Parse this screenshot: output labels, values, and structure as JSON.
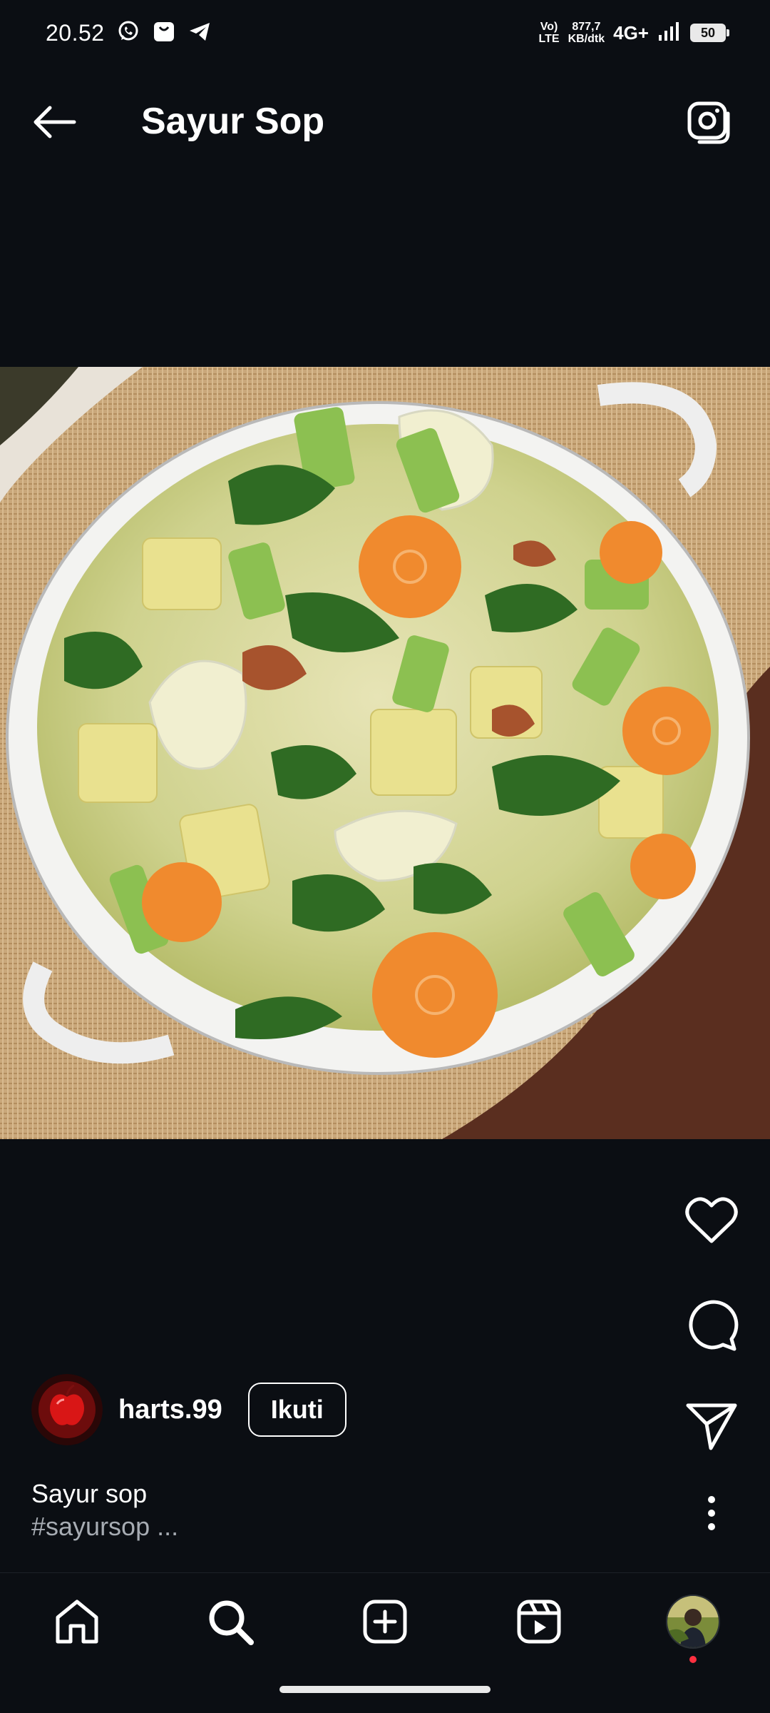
{
  "status_bar": {
    "time": "20.52",
    "volte_line1": "Vo)",
    "volte_line2": "LTE",
    "speed_line1": "877,7",
    "speed_line2": "KB/dtk",
    "network": "4G+",
    "battery": "50",
    "left_icons": [
      "whatsapp-icon",
      "shopping-bag-icon",
      "telegram-icon"
    ]
  },
  "header": {
    "title": "Sayur Sop",
    "back_icon": "arrow-left-icon",
    "camera_icon": "camera-icon"
  },
  "post": {
    "image_subject": "vegetable-soup-photo",
    "author": {
      "username": "harts.99",
      "follow_label": "Ikuti"
    },
    "caption": {
      "title": "Sayur sop",
      "tags": "#sayursop ..."
    },
    "actions": [
      "heart-icon",
      "comment-icon",
      "send-icon",
      "more-vertical-icon"
    ]
  },
  "bottom_nav": {
    "items": [
      "home-icon",
      "search-icon",
      "create-icon",
      "reels-icon",
      "profile-avatar"
    ]
  },
  "colors": {
    "background": "#0b0e13",
    "text": "#ffffff",
    "muted_text": "#a7acb3",
    "notification_dot": "#ff3040"
  }
}
